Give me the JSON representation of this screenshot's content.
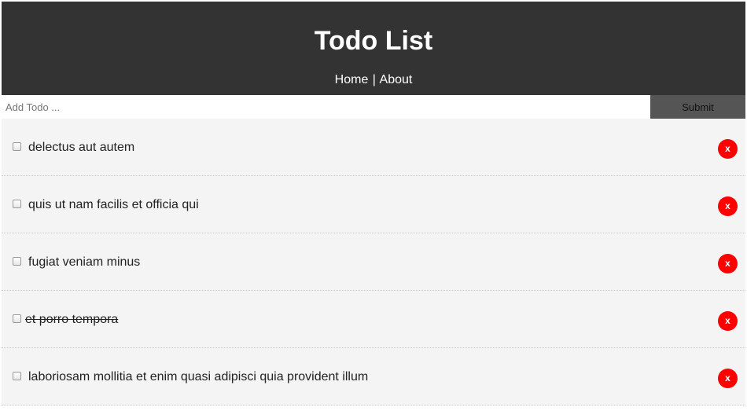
{
  "header": {
    "title": "Todo List",
    "nav": {
      "home_label": "Home",
      "separator": "|",
      "about_label": "About"
    }
  },
  "add_form": {
    "input_value": "",
    "input_placeholder": "Add Todo ...",
    "submit_label": "Submit"
  },
  "todos": [
    {
      "title": "delectus aut autem",
      "completed": false,
      "delete_label": "x"
    },
    {
      "title": "quis ut nam facilis et officia qui",
      "completed": false,
      "delete_label": "x"
    },
    {
      "title": "fugiat veniam minus",
      "completed": false,
      "delete_label": "x"
    },
    {
      "title": "et porro tempora",
      "completed": true,
      "delete_label": "x"
    },
    {
      "title": "laboriosam mollitia et enim quasi adipisci quia provident illum",
      "completed": false,
      "delete_label": "x"
    }
  ],
  "colors": {
    "header_bg": "#333333",
    "submit_bg": "#555555",
    "item_bg": "#f4f4f4",
    "delete_bg": "#ff0000"
  }
}
